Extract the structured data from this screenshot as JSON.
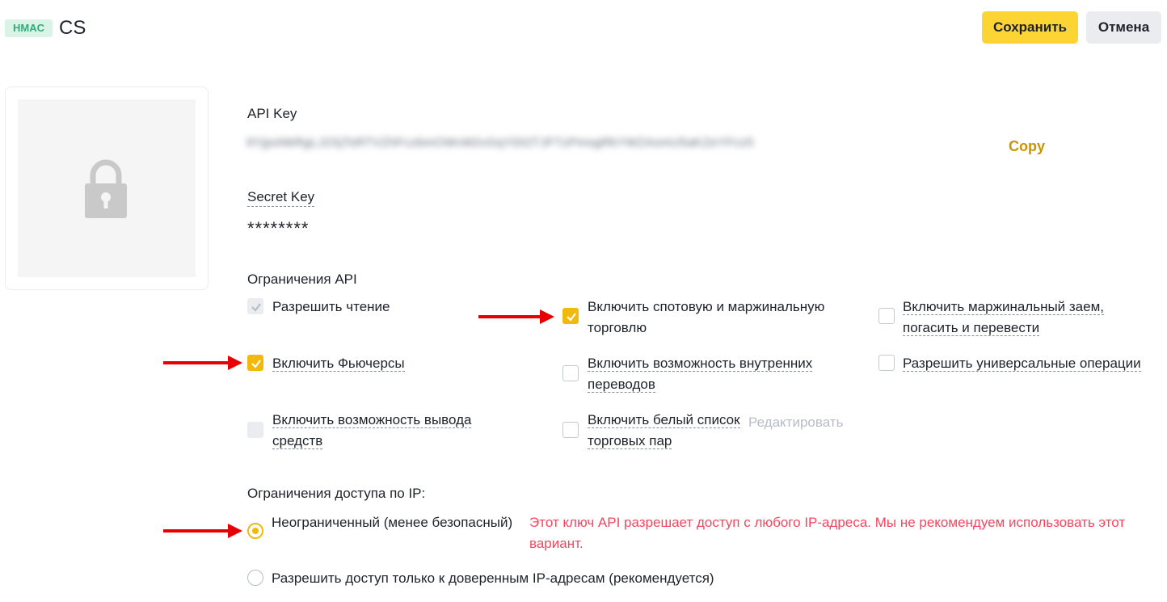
{
  "header": {
    "badge": "HMAC",
    "title": "CS",
    "save_label": "Сохранить",
    "cancel_label": "Отмена"
  },
  "keys": {
    "api_key_label": "API Key",
    "api_key_value": "9YjpsNkRgLJ2SjTsRTVZhFczbmOWcM2vGqYDt2TJFTzPmsgRkYWZAsmU5aKZeYFcz5",
    "copy_label": "Copy",
    "secret_key_label": "Secret Key",
    "secret_key_value": "********"
  },
  "restrictions": {
    "title": "Ограничения API",
    "options": [
      {
        "label": "Разрешить чтение",
        "checked": true,
        "disabled": true
      },
      {
        "label": "Включить спотовую и маржинальную торговлю",
        "checked": true,
        "disabled": false
      },
      {
        "label": "Включить маржинальный заем, погасить и перевести",
        "checked": false,
        "disabled": false
      },
      {
        "label": "Включить Фьючерсы",
        "checked": true,
        "disabled": false
      },
      {
        "label": "Включить возможность внутренних переводов",
        "checked": false,
        "disabled": false
      },
      {
        "label": "Разрешить универсальные операции",
        "checked": false,
        "disabled": false
      },
      {
        "label": "Включить возможность вывода средств",
        "checked": false,
        "disabled": true
      },
      {
        "label": "Включить белый список торговых пар",
        "checked": false,
        "disabled": false
      }
    ],
    "edit_label": "Редактировать"
  },
  "ip": {
    "title": "Ограничения доступа по IP:",
    "unrestricted_label": "Неограниченный (менее безопасный)",
    "warning": "Этот ключ API разрешает доступ с любого IP-адреса. Мы не рекомендуем использовать этот вариант.",
    "trusted_label": "Разрешить доступ только к доверенным IP-адресам (рекомендуется)",
    "selected": "unrestricted"
  },
  "colors": {
    "accent": "#fcd535",
    "checkbox": "#f0b90b",
    "warning": "#f6465d",
    "annotation_arrow": "#e60000",
    "badge_bg": "#d9f3e7",
    "badge_text": "#2fae7a"
  }
}
